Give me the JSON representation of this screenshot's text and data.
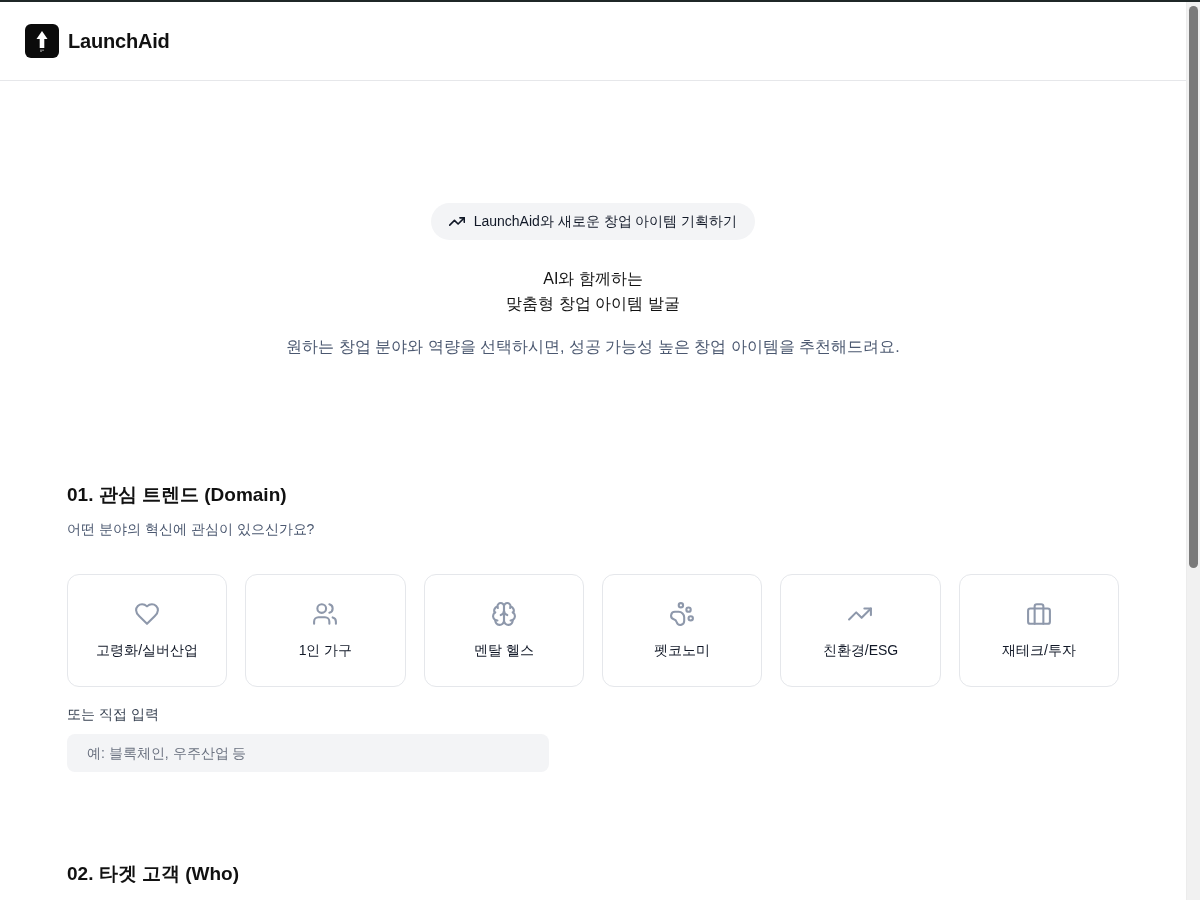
{
  "header": {
    "brand": "LaunchAid"
  },
  "hero": {
    "badge": "LaunchAid와 새로운 창업 아이템 기획하기",
    "title": "AI와 함께하는\n맞춤형 창업 아이템 발굴",
    "subtitle": "원하는 창업 분야와 역량을 선택하시면, 성공 가능성 높은 창업 아이템을 추천해드려요."
  },
  "sections": [
    {
      "heading": "01. 관심 트렌드 (Domain)",
      "question": "어떤 분야의 혁신에 관심이 있으신가요?",
      "options": [
        {
          "label": "고령화/실버산업",
          "selected": false
        },
        {
          "label": "1인 가구",
          "selected": false
        },
        {
          "label": "멘탈 헬스",
          "selected": false
        },
        {
          "label": "펫코노미",
          "selected": false
        },
        {
          "label": "친환경/ESG",
          "selected": false
        },
        {
          "label": "재테크/투자",
          "selected": false
        }
      ],
      "custom_input": {
        "label": "또는 직접 입력",
        "placeholder": "예: 블록체인, 우주산업 등"
      }
    },
    {
      "heading": "02. 타겟 고객 (Who)"
    }
  ]
}
